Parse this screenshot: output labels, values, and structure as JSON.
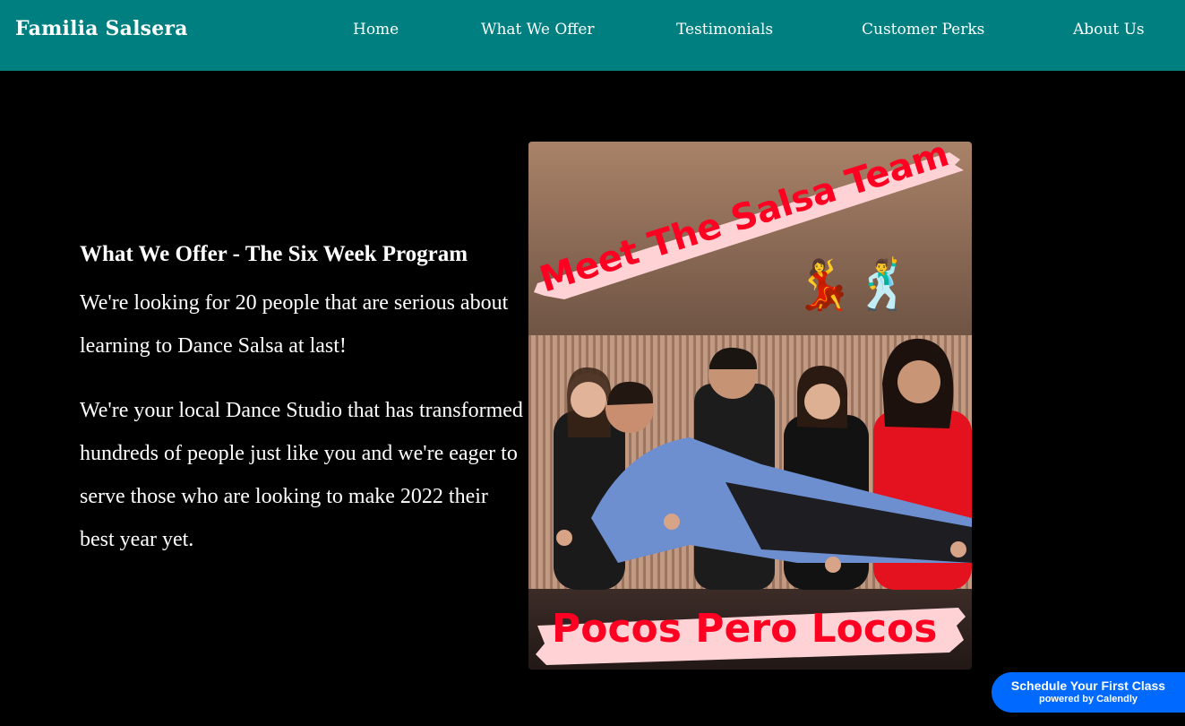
{
  "header": {
    "brand": "Familia Salsera",
    "nav": [
      {
        "label": "Home"
      },
      {
        "label": "What We Offer"
      },
      {
        "label": "Testimonials"
      },
      {
        "label": "Customer Perks"
      },
      {
        "label": "About Us"
      }
    ]
  },
  "main": {
    "heading": "What We Offer - The Six Week Program",
    "paragraph_1": "We're looking for 20 people that are serious about learning to Dance Salsa at last!",
    "paragraph_2": "We're your local Dance Studio that has transformed hundreds of people just like you and we're eager to serve those who are looking to make 2022 their best year yet."
  },
  "team_image": {
    "top_banner": "Meet The Salsa Team",
    "emoji": "💃🕺",
    "bottom_banner": "Pocos Pero Locos"
  },
  "calendly_widget": {
    "label": "Schedule Your First Class",
    "sublabel": "powered by Calendly"
  },
  "colors": {
    "header_bg": "#007f80",
    "page_bg": "#000000",
    "banner_text": "#ff0022",
    "banner_brush": "#ffd3d6",
    "cta_bg": "#0069ff"
  }
}
